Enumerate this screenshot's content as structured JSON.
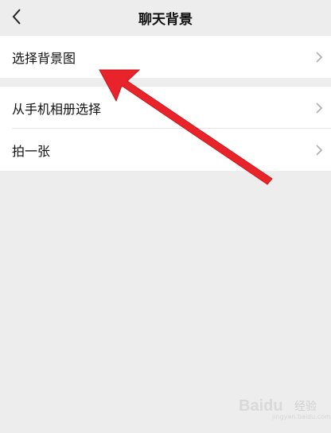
{
  "nav": {
    "title": "聊天背景",
    "back_icon": "chevron-left-icon"
  },
  "options": {
    "group1": [
      {
        "label": "选择背景图",
        "icon": "chevron-right-icon"
      }
    ],
    "group2": [
      {
        "label": "从手机相册选择",
        "icon": "chevron-right-icon"
      },
      {
        "label": "拍一张",
        "icon": "chevron-right-icon"
      }
    ]
  },
  "annotation": {
    "color": "#e8232a",
    "icon": "red-arrow"
  },
  "watermark": {
    "brand": "Baidu",
    "label": "经验",
    "url": "jingyan.baidu.com"
  }
}
